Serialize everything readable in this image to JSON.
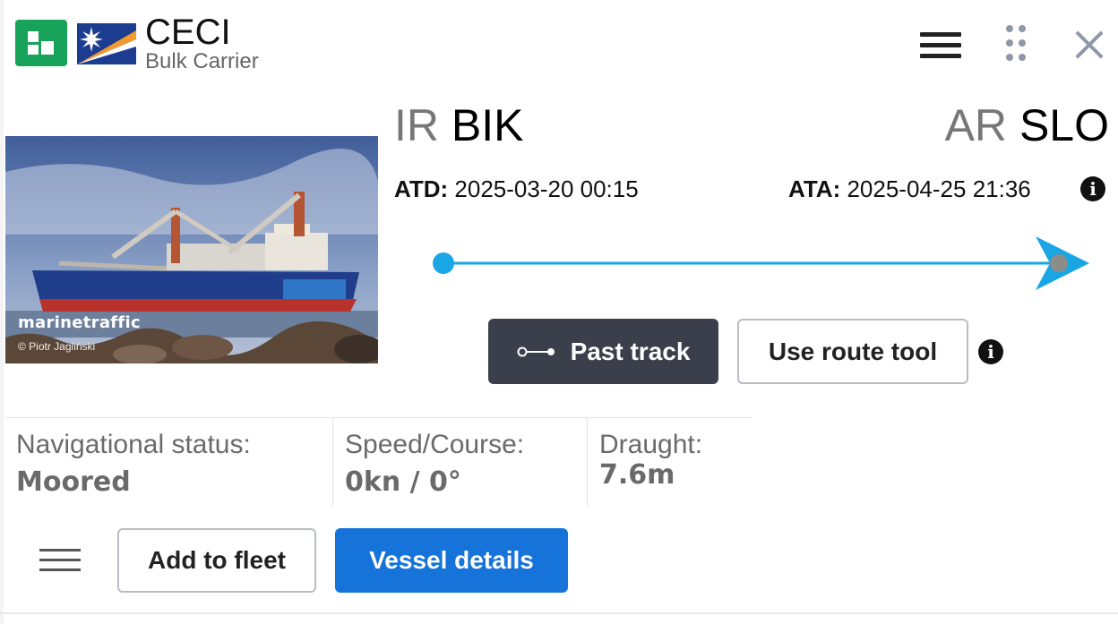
{
  "header": {
    "vessel_name": "CECI",
    "vessel_type": "Bulk Carrier",
    "flag_icon": "marshall-islands-flag",
    "app_icon": "marinetraffic-app-icon",
    "colors": {
      "app_icon": "#17a35a",
      "flag_blue": "#1b3c8f",
      "flag_orange": "#f29a2e"
    }
  },
  "photo": {
    "brand": "marinetraffic",
    "credit": "© Piotr Jagliński"
  },
  "route": {
    "departure": {
      "prefix": "IR",
      "code": "BIK"
    },
    "arrival": {
      "prefix": "AR",
      "code": "SLO"
    },
    "atd_label": "ATD:",
    "atd_value": "2025-03-20 00:15",
    "ata_label": "ATA:",
    "ata_value": "2025-04-25 21:36",
    "progress": 1.0,
    "colors": {
      "line": "#1aa6e4",
      "vessel_marker": "#8c8c8c"
    }
  },
  "actions": {
    "past_track": "Past track",
    "route_tool": "Use route tool"
  },
  "stats": {
    "nav_status_label": "Navigational status:",
    "nav_status_value": "Moored",
    "speed_label": "Speed/Course:",
    "speed_value": "0kn / 0°",
    "draught_label": "Draught:",
    "draught_value": "7.6m"
  },
  "footer": {
    "add_fleet": "Add to fleet",
    "vessel_details": "Vessel details",
    "colors": {
      "primary": "#1673d9",
      "dark": "#3a3f4b"
    }
  }
}
